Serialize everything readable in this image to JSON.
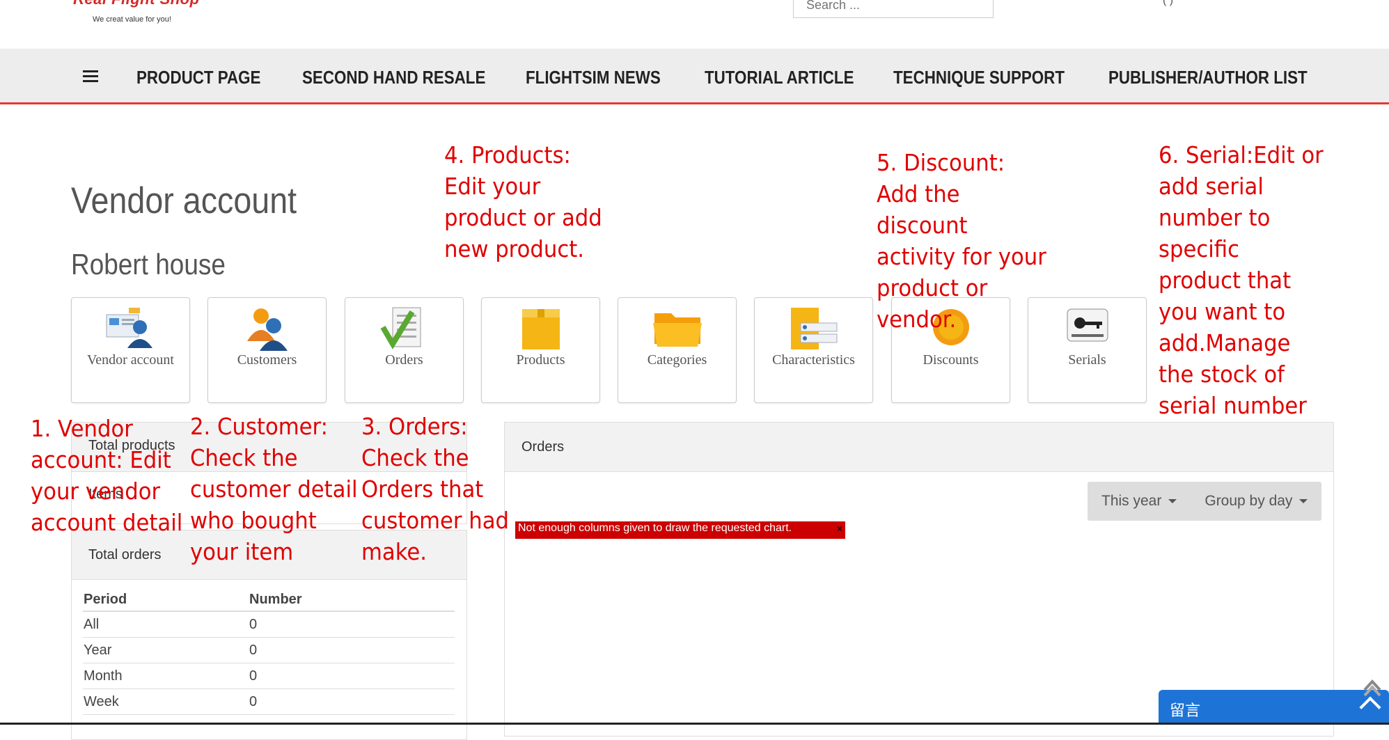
{
  "header": {
    "logo_text": "Real Flight Shop",
    "logo_tagline": "We creat value for you!",
    "search_placeholder": "Search ...",
    "top_misc": "( )"
  },
  "nav": {
    "items": [
      "PRODUCT PAGE",
      "SECOND HAND RESALE",
      "FLIGHTSIM NEWS",
      "TUTORIAL ARTICLE",
      "TECHNIQUE SUPPORT",
      "PUBLISHER/AUTHOR LIST"
    ]
  },
  "page": {
    "title": "Vendor account",
    "vendor_name": "Robert house"
  },
  "tiles": [
    {
      "label": "Vendor account",
      "icon": "vendor-account-icon"
    },
    {
      "label": "Customers",
      "icon": "customers-icon"
    },
    {
      "label": "Orders",
      "icon": "orders-icon"
    },
    {
      "label": "Products",
      "icon": "products-box-icon"
    },
    {
      "label": "Categories",
      "icon": "folder-icon"
    },
    {
      "label": "Characteristics",
      "icon": "characteristics-icon"
    },
    {
      "label": "Discounts",
      "icon": "discount-badge-icon"
    },
    {
      "label": "Serials",
      "icon": "key-icon"
    }
  ],
  "panels": {
    "total_products_title": "Total products",
    "items_label": "Items",
    "total_orders_title": "Total orders",
    "orders_table": {
      "headers": [
        "Period",
        "Number"
      ],
      "rows": [
        [
          "All",
          "0"
        ],
        [
          "Year",
          "0"
        ],
        [
          "Month",
          "0"
        ],
        [
          "Week",
          "0"
        ]
      ]
    },
    "orders_chart_title": "Orders",
    "period_button": "This year",
    "group_button": "Group by day",
    "chart_error": "Not enough columns given to draw the requested chart.",
    "error_close": "×"
  },
  "annotations": {
    "n1": "1. Vendor\naccount: Edit\nyour vendor\naccount detail",
    "n2": "2. Customer:\nCheck the\ncustomer detail\nwho bought\nyour item",
    "n3": "3. Orders:\nCheck the\nOrders that\ncustomer had\nmake.",
    "n4": "4. Products:\nEdit your\nproduct or add\nnew product.",
    "n5": "5. Discount:\nAdd the\ndiscount\nactivity for your\nproduct or\nvendor.",
    "n6": "6. Serial:Edit or\nadd serial\nnumber to\nspecific\nproduct that\nyou want to\nadd.Manage\nthe stock of\nserial number"
  },
  "chat": {
    "label": "留言"
  },
  "colors": {
    "accent_red": "#e23a2e",
    "annotation_red": "#e00000",
    "chat_blue": "#1e73d6"
  }
}
